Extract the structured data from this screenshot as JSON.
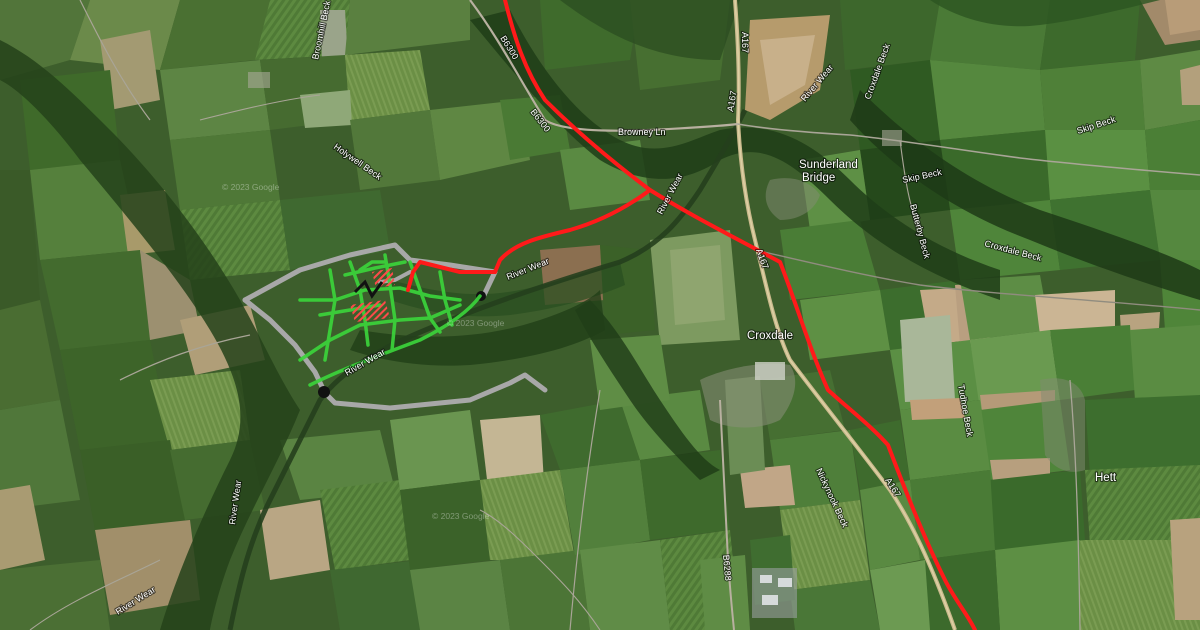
{
  "map": {
    "base_layer": "satellite imagery",
    "copyright": "© 2023 Google",
    "places": {
      "sunderland_bridge": [
        "Sunderland",
        "Bridge"
      ],
      "croxdale": "Croxdale",
      "hett": "Hett"
    },
    "roads": {
      "a167": "A167",
      "b6300": "B6300",
      "b6288": "B6288",
      "browney_ln": "Browney Ln"
    },
    "waterways": {
      "river_wear": "River Wear",
      "holywell_beck": "Holywell Beck",
      "skip_beck": "Skip Beck",
      "croxdale_beck": "Croxdale Beck",
      "butterby_beck": "Butterby Beck",
      "nickynook_beck": "Nickynook Beck",
      "tudhoe_beck": "Tudhoe Beck",
      "broomhill_beck": "Broomhill Beck"
    },
    "overlay_colors": {
      "route_red": "#ff1a1a",
      "route_grey": "#a8a8a8",
      "path_green": "#3bd43b",
      "hatch_red": "#ff4040",
      "marker_black": "#111111"
    }
  }
}
